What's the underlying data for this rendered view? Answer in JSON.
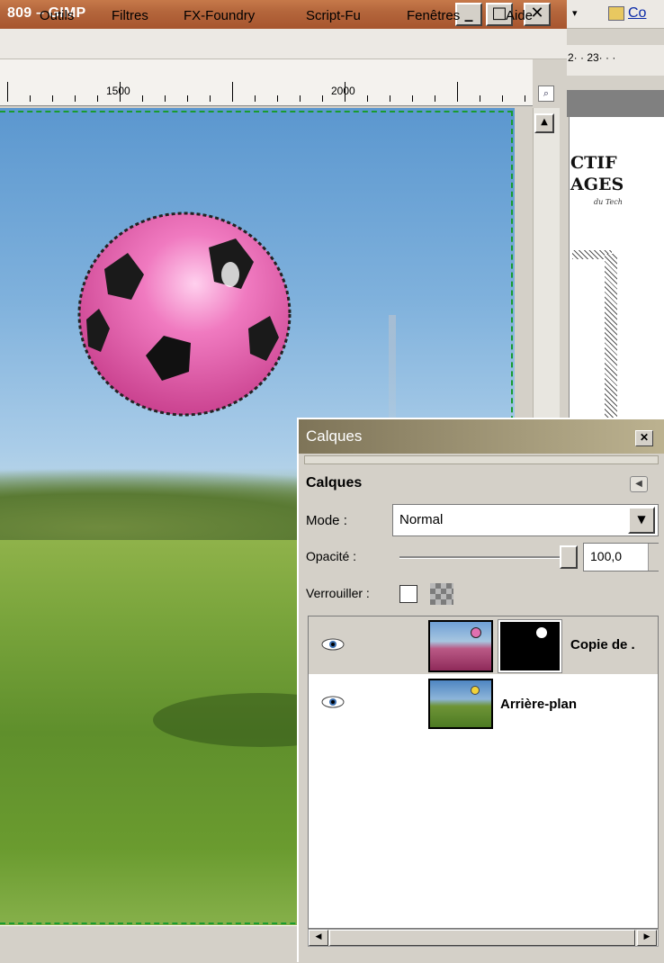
{
  "window": {
    "title": "809 – GIMP",
    "minimize": "_",
    "maximize": "□",
    "close": "✕"
  },
  "menu": [
    "Outils",
    "Filtres",
    "FX-Foundry",
    "Script-Fu",
    "Fenêtres",
    "Aide"
  ],
  "ruler": {
    "labels": [
      "1500",
      "2000"
    ]
  },
  "right_doc": {
    "toolbar_label": "Co",
    "page_tabs": "2· · 23· · ·",
    "title_line1": "CTIF",
    "title_line2": "AGES",
    "small_text": "du Tech"
  },
  "layers_dialog": {
    "title": "Calques",
    "header": "Calques",
    "mode_label": "Mode :",
    "mode_value": "Normal",
    "opacity_label": "Opacité :",
    "opacity_value": "100,0",
    "opacity_percent": 100,
    "lock_label": "Verrouiller :",
    "layers": [
      {
        "name": "Copie de .",
        "visible": true,
        "selected": true,
        "has_mask": true
      },
      {
        "name": "Arrière-plan",
        "visible": true,
        "selected": false,
        "has_mask": false
      }
    ]
  },
  "colors": {
    "title_bar": "#b4663c",
    "selection_marching_ants": "#1a9b2f",
    "ball": "#e060a8"
  }
}
